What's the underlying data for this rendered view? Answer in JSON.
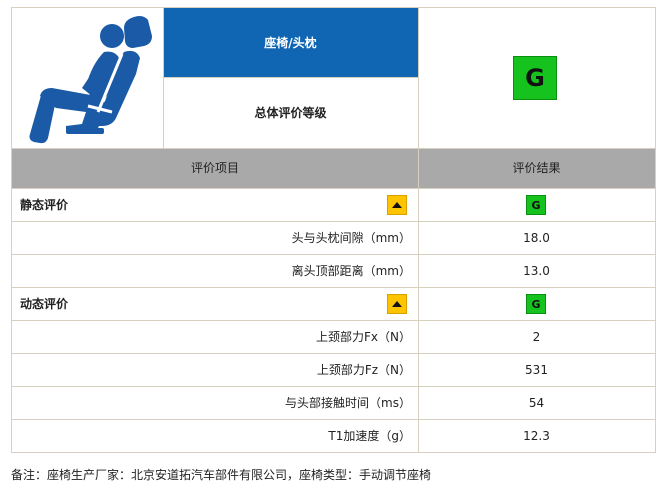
{
  "header": {
    "category_label": "座椅/头枕",
    "overall_label": "总体评价等级",
    "overall_grade": "G",
    "icon_name": "seat-headrest-icon"
  },
  "columns": {
    "item_header": "评价项目",
    "result_header": "评价结果"
  },
  "sections": [
    {
      "title": "静态评价",
      "trend_icon": "up-triangle-icon",
      "grade": "G",
      "rows": [
        {
          "label": "头与头枕间隙（mm）",
          "value": "18.0"
        },
        {
          "label": "离头顶部距离（mm）",
          "value": "13.0"
        }
      ]
    },
    {
      "title": "动态评价",
      "trend_icon": "up-triangle-icon",
      "grade": "G",
      "rows": [
        {
          "label": "上颈部力Fx（N）",
          "value": "2"
        },
        {
          "label": "上颈部力Fz（N）",
          "value": "531"
        },
        {
          "label": "与头部接触时间（ms）",
          "value": "54"
        },
        {
          "label": "T1加速度（g）",
          "value": "12.3"
        }
      ]
    }
  ],
  "footnote": "备注：座椅生产厂家：北京安道拓汽车部件有限公司，座椅类型：手动调节座椅",
  "colors": {
    "header_blue": "#1166b3",
    "column_header_gray": "#a9a9a9",
    "grade_green": "#16c21e",
    "warn_yellow": "#ffc400",
    "icon_blue": "#1a5aa6"
  }
}
